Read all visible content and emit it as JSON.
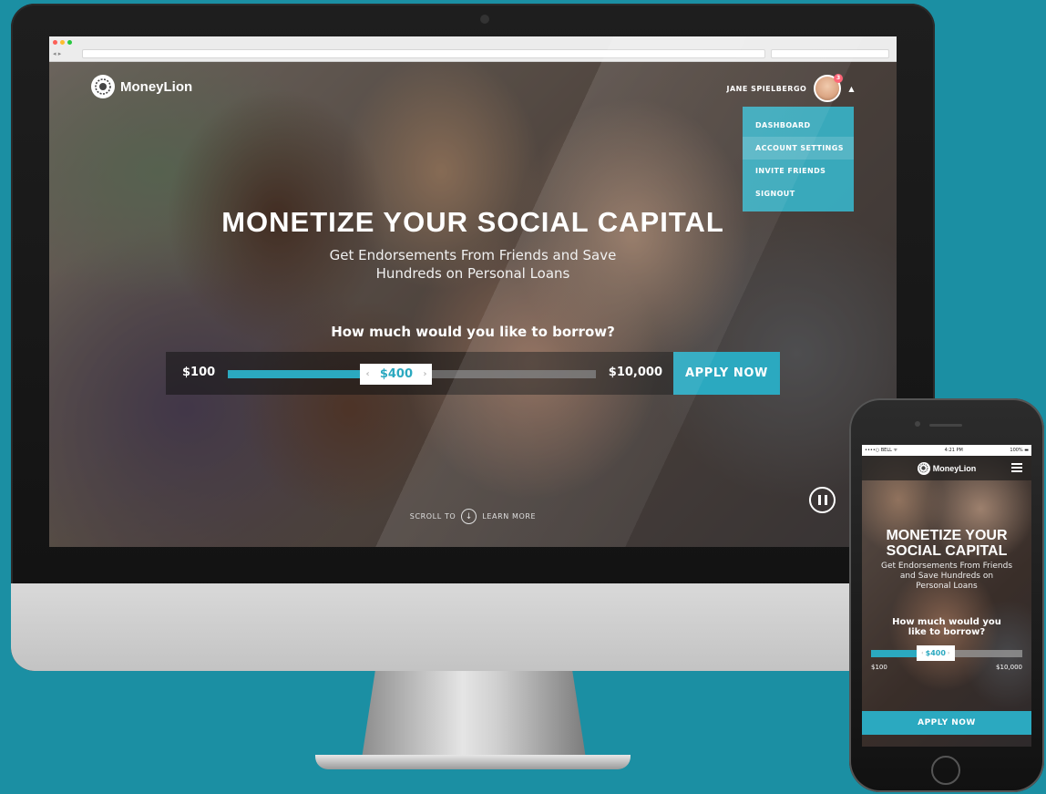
{
  "colors": {
    "background": "#1b8fa3",
    "accent": "#2ba9c0",
    "dropdown_bg": "#38b2c7"
  },
  "brand": {
    "name": "MoneyLion",
    "logo_icon": "lion-head-icon"
  },
  "user": {
    "name": "JANE SPIELBERGO",
    "avatar_icon": "user-avatar",
    "caret_icon": "caret-up-icon",
    "notification_count": "3"
  },
  "dropdown": {
    "items": [
      {
        "label": "DASHBOARD"
      },
      {
        "label": "ACCOUNT SETTINGS"
      },
      {
        "label": "INVITE FRIENDS"
      },
      {
        "label": "SIGNOUT"
      }
    ],
    "active_index": 1
  },
  "hero": {
    "headline": "MONETIZE YOUR SOCIAL CAPITAL",
    "subhead_line1": "Get Endorsements From Friends and Save",
    "subhead_line2": "Hundreds on Personal Loans",
    "question": "How much would you like to borrow?"
  },
  "slider": {
    "min_label": "$100",
    "max_label": "$10,000",
    "value_label": "$400",
    "fill_fraction": 0.36,
    "left_arrow": "‹",
    "right_arrow": "›"
  },
  "apply_button": "APPLY NOW",
  "scroll": {
    "left_text": "SCROLL TO",
    "right_text": "LEARN MORE",
    "icon": "arrow-down-circle-icon"
  },
  "pause_icon": "pause-icon",
  "mobile": {
    "status_left": "••••○ BELL ᯤ",
    "status_time": "4:21 PM",
    "status_right": "100% ▬",
    "brand": "MoneyLion",
    "menu_icon": "hamburger-menu-icon",
    "headline_line1": "MONETIZE YOUR",
    "headline_line2": "SOCIAL CAPITAL",
    "sub_line1": "Get Endorsements From Friends",
    "sub_line2": "and Save Hundreds on",
    "sub_line3": "Personal Loans",
    "question_line1": "How much would you",
    "question_line2": "like to borrow?",
    "slider_value": "$400",
    "slider_fill_fraction": 0.3,
    "min_label": "$100",
    "max_label": "$10,000",
    "apply_button": "APPLY NOW"
  }
}
